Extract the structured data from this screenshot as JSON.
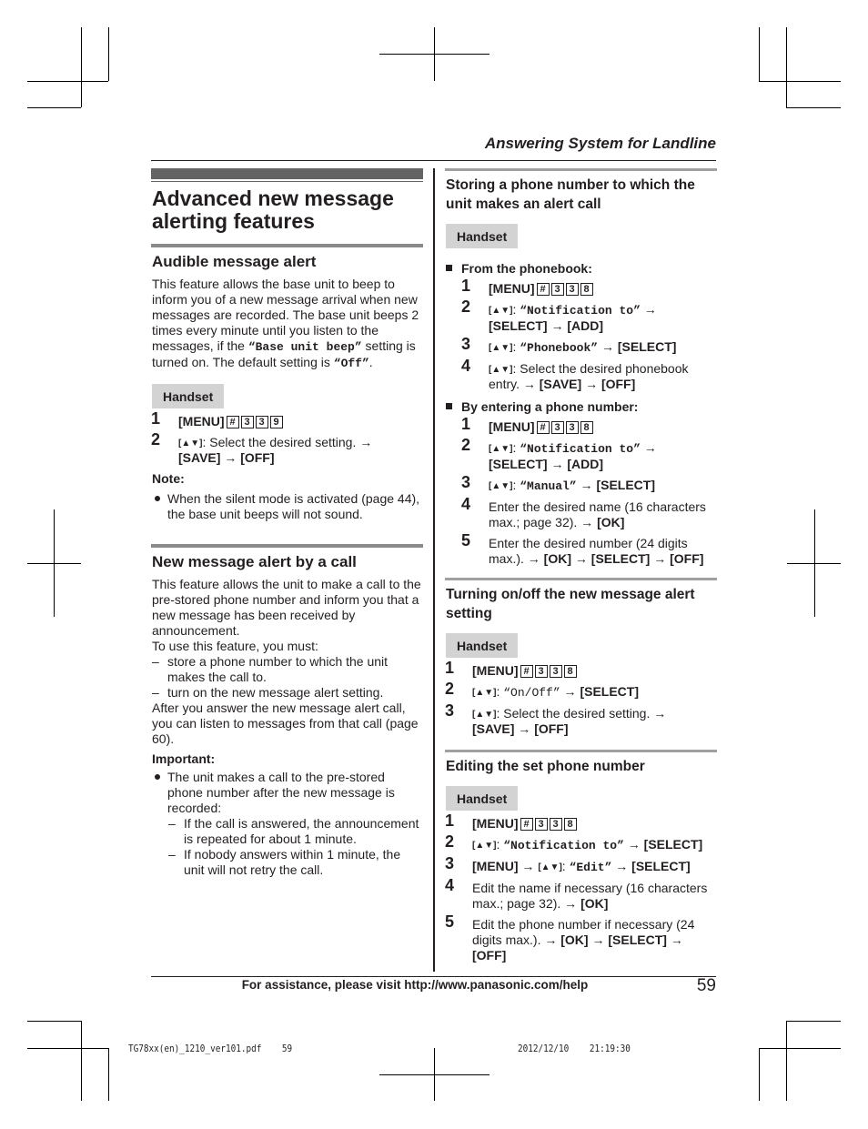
{
  "running_head": "Answering System for Landline",
  "left": {
    "page_title_line1": "Advanced new message",
    "page_title_line2": "alerting features",
    "audible": {
      "title": "Audible message alert",
      "para_a": "This feature allows the base unit to beep to inform you of a new message arrival when new messages are recorded. The base unit beeps 2 times every minute until you listen to the messages, if the ",
      "setting_name": "“Base unit beep”",
      "para_b": " setting is turned on. The default setting is ",
      "default_value": "“Off”",
      "para_c": ".",
      "handset_label": "Handset",
      "steps": [
        {
          "num": "1",
          "menu": "[MENU]",
          "keys": [
            "#",
            "3",
            "3",
            "9"
          ]
        },
        {
          "num": "2",
          "nav": "[▲▼]",
          "text": ": Select the desired setting. → ",
          "line2": "[SAVE] → [OFF]"
        }
      ],
      "note_label": "Note:",
      "note": "When the silent mode is activated (page 44), the base unit beeps will not sound."
    },
    "call": {
      "title": "New message alert by a call",
      "intro": "This feature allows the unit to make a call to the pre-stored phone number and inform you that a new message has been received by announcement.",
      "must": "To use this feature, you must:",
      "must_items": [
        "store a phone number to which the unit makes the call to.",
        "turn on the new message alert setting."
      ],
      "after": "After you answer the new message alert call, you can listen to messages from that call (page 60).",
      "important_label": "Important:",
      "important": "The unit makes a call to the pre-stored phone number after the new message is recorded:",
      "important_items": [
        "If the call is answered, the announcement is repeated for about 1 minute.",
        "If nobody answers within 1 minute, the unit will not retry the call."
      ]
    }
  },
  "right": {
    "storing": {
      "title": "Storing a phone number to which the unit makes an alert call",
      "handset_label": "Handset",
      "from_phonebook": "From the phonebook:",
      "pb_steps": [
        {
          "num": "1",
          "menu": "[MENU]",
          "keys": [
            "#",
            "3",
            "3",
            "8"
          ]
        },
        {
          "num": "2",
          "nav": "[▲▼]",
          "sep": ": ",
          "mono": "“Notification to”",
          "tail": " →",
          "line2": "[SELECT] → [ADD]"
        },
        {
          "num": "3",
          "nav": "[▲▼]",
          "sep": ": ",
          "mono": "“Phonebook”",
          "tail": " → [SELECT]"
        },
        {
          "num": "4",
          "nav": "[▲▼]",
          "text": ": Select the desired phonebook entry. → ",
          "bold_tail": "[SAVE] → [OFF]"
        }
      ],
      "by_entering": "By entering a phone number:",
      "en_steps": [
        {
          "num": "1",
          "menu": "[MENU]",
          "keys": [
            "#",
            "3",
            "3",
            "8"
          ]
        },
        {
          "num": "2",
          "nav": "[▲▼]",
          "sep": ": ",
          "mono": "“Notification to”",
          "tail": " →",
          "line2": "[SELECT] → [ADD]"
        },
        {
          "num": "3",
          "nav": "[▲▼]",
          "sep": ": ",
          "mono": "“Manual”",
          "tail": " → [SELECT]"
        },
        {
          "num": "4",
          "text": "Enter the desired name (16 characters max.; page 32). → ",
          "bold_tail": "[OK]"
        },
        {
          "num": "5",
          "text": "Enter the desired number (24 digits max.). → ",
          "bold_tail": "[OK] → [SELECT] → [OFF]"
        }
      ]
    },
    "turning": {
      "title": "Turning on/off the new message alert setting",
      "handset_label": "Handset",
      "steps": [
        {
          "num": "1",
          "menu": "[MENU]",
          "keys": [
            "#",
            "3",
            "3",
            "8"
          ]
        },
        {
          "num": "2",
          "nav": "[▲▼]",
          "sep": ": ",
          "mono": "“On/Off”",
          "tail": " → [SELECT]"
        },
        {
          "num": "3",
          "nav": "[▲▼]",
          "text": ": Select the desired setting. → ",
          "line2": "[SAVE] → [OFF]"
        }
      ]
    },
    "editing": {
      "title": "Editing the set phone number",
      "handset_label": "Handset",
      "steps": [
        {
          "num": "1",
          "menu": "[MENU]",
          "keys": [
            "#",
            "3",
            "3",
            "8"
          ]
        },
        {
          "num": "2",
          "nav": "[▲▼]",
          "sep": ": ",
          "mono": "“Notification to”",
          "tail": " → [SELECT]"
        },
        {
          "num": "3",
          "pre": "[MENU] → ",
          "nav": "[▲▼]",
          "sep": ": ",
          "mono": "“Edit”",
          "tail": " → [SELECT]"
        },
        {
          "num": "4",
          "text": "Edit the name if necessary (16 characters max.; page 32). → ",
          "bold_tail": "[OK]"
        },
        {
          "num": "5",
          "text": "Edit the phone number if necessary (24 digits max.). → ",
          "bold_tail": "[OK] → [SELECT] → [OFF]"
        }
      ]
    }
  },
  "footer": {
    "assistance": "For assistance, please visit http://www.panasonic.com/help",
    "page_number": "59"
  },
  "print_info": {
    "file": "TG78xx(en)_1210_ver101.pdf",
    "page": "59",
    "date": "2012/12/10",
    "time": "21:19:30"
  }
}
